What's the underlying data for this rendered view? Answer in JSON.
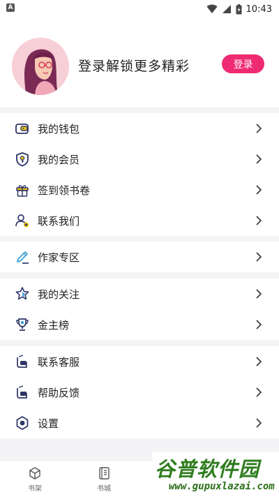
{
  "status_bar": {
    "time": "10:43",
    "left_badge": "A"
  },
  "profile": {
    "login_hint": "登录解锁更多精彩",
    "login_button": "登录"
  },
  "menu": {
    "wallet": "我的钱包",
    "membership": "我的会员",
    "checkin": "签到领书卷",
    "contact_us": "联系我们",
    "author_zone": "作家专区",
    "following": "我的关注",
    "gold_list": "金主榜",
    "customer_service": "联系客服",
    "feedback": "帮助反馈",
    "settings": "设置"
  },
  "tabbar": {
    "bookshelf": "书架",
    "bookstore": "书城"
  },
  "watermark": {
    "top": "谷普软件园",
    "bottom": "www.gupuxlazai.com"
  },
  "colors": {
    "accent": "#ee2a72",
    "icon_navy": "#2c3566",
    "icon_yellow": "#f5c518",
    "watermark_green": "#2f7d1f"
  }
}
